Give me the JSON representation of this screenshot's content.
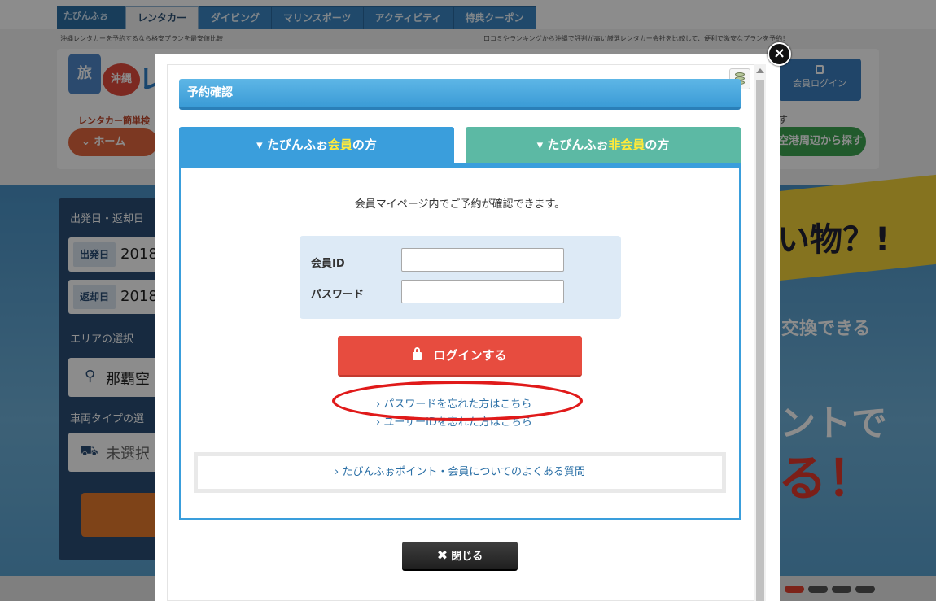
{
  "site": {
    "brand": "たびんふぉ",
    "tabs": [
      "レンタカー",
      "ダイビング",
      "マリンスポーツ",
      "アクティビティ",
      "特典クーポン"
    ],
    "tagline_left": "沖縄レンタカーを予約するなら格安プランを最安値比較",
    "tagline_right": "口コミやランキングから沖縄で評判が高い厳選レンタカー会社を比較して、便利で激安なプランを予約！",
    "logo": {
      "box": "旅",
      "mark": "沖縄",
      "char": "レ"
    },
    "crumb_label": "レンタカー簡単検",
    "home": "ホーム",
    "member_login": "会員ログイン",
    "nearby": "空港周辺から探す",
    "su": "す"
  },
  "search_panel": {
    "dates_label": "出発日・返却日",
    "depart_tag": "出発日",
    "depart_value": "2018",
    "return_tag": "返却日",
    "return_value": "2018",
    "area_label": "エリアの選択",
    "area_value": "那覇空",
    "vehicle_label": "車両タイプの選",
    "vehicle_value": "未選択"
  },
  "hero": {
    "line1": "い物？!",
    "line2": "交換できる",
    "line3": "ントで",
    "line4": "る！"
  },
  "modal": {
    "title": "予約確認",
    "tab_member": {
      "pre": "たびんふぉ",
      "hl": "会員",
      "post": "の方"
    },
    "tab_guest": {
      "pre": "たびんふぉ",
      "hl": "非会員",
      "post": "の方"
    },
    "intro": "会員マイページ内でご予約が確認できます。",
    "member_id_label": "会員ID",
    "password_label": "パスワード",
    "member_id_value": "",
    "password_value": "",
    "login_button": "ログインする",
    "forgot_password": "パスワードを忘れた方はこちら",
    "forgot_userid": "ユーザーIDを忘れた方はこちら",
    "faq": "たびんふぉポイント・会員についてのよくある質問",
    "close_button": "閉じる",
    "close_x": "×"
  },
  "colors": {
    "title_bar": "#3a9bd6",
    "member_tab": "#3a9edc",
    "guest_tab": "#5cb9a4",
    "login_button": "#e74c3f",
    "highlight_ellipse": "#e01a1a"
  }
}
